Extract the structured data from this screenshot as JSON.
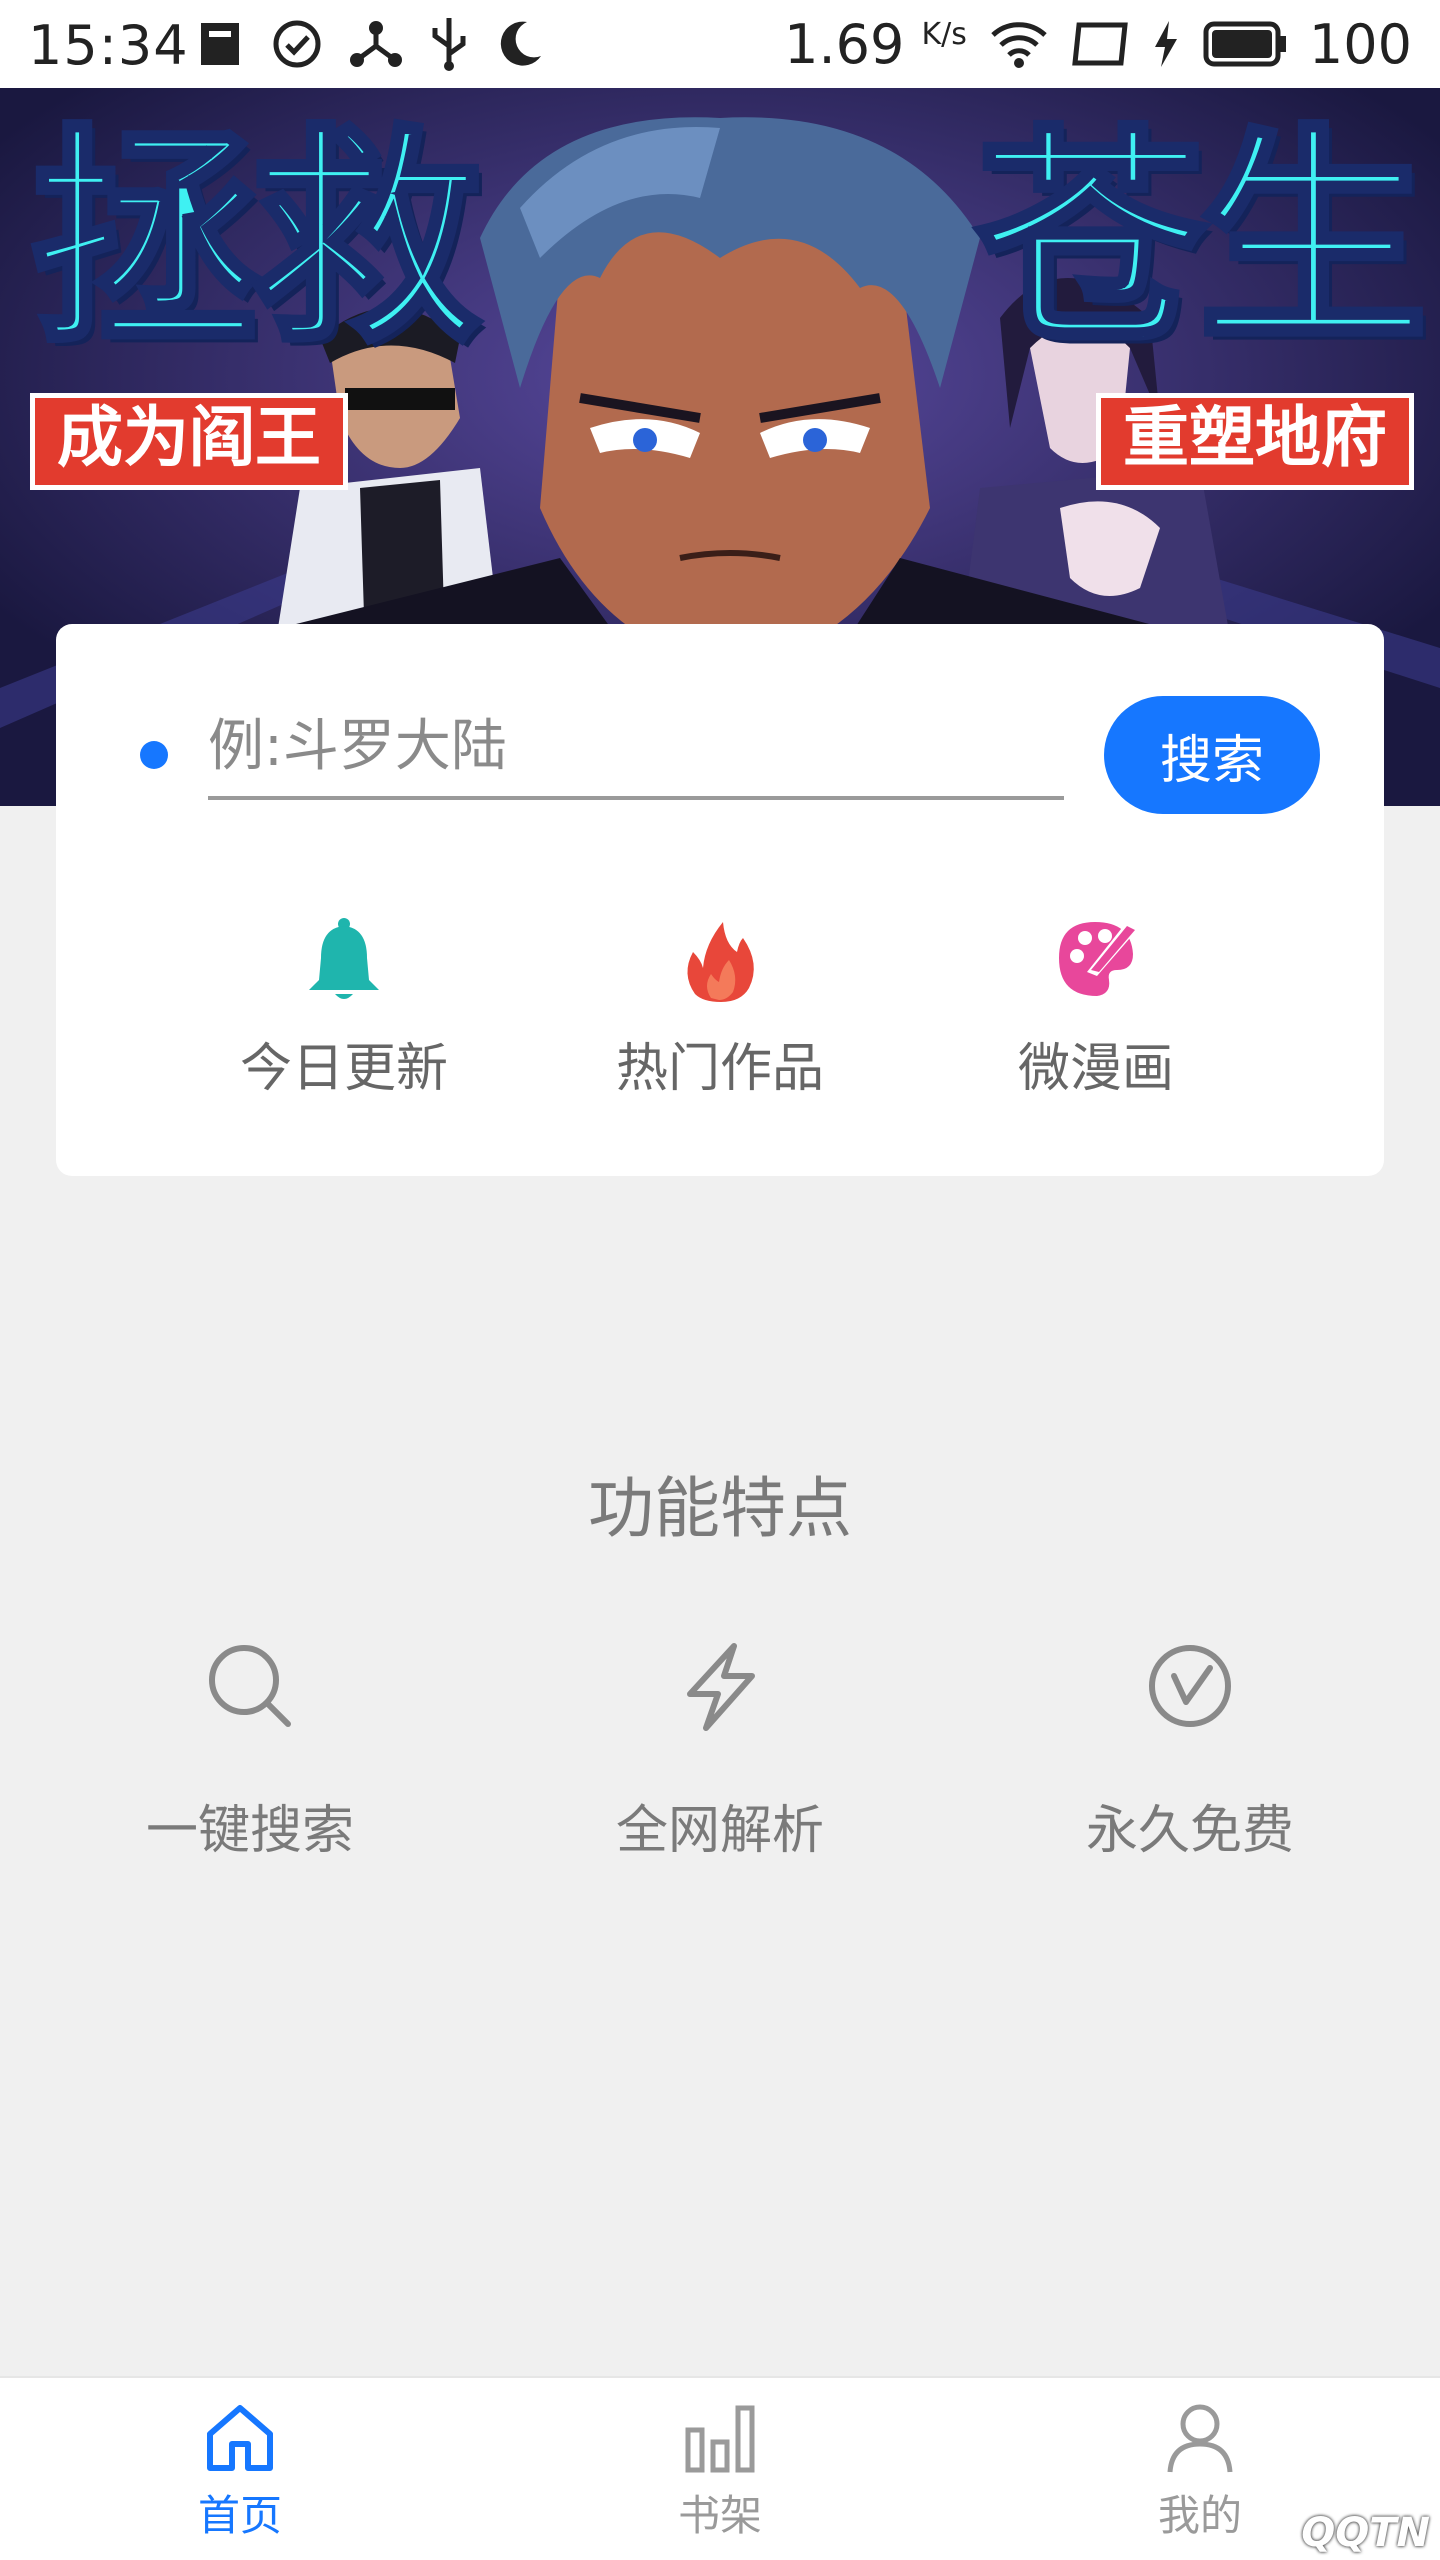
{
  "status_bar": {
    "time": "15:34",
    "net_speed": "1.69",
    "net_speed_unit": "K/s",
    "battery": "100",
    "left_icons": [
      "sd-card-icon",
      "check-circle-icon",
      "share-node-icon",
      "usb-icon",
      "moon-icon"
    ],
    "right_icons": [
      "wifi-icon",
      "screen-icon",
      "charging-icon",
      "battery-icon"
    ]
  },
  "banner": {
    "title_left": "拯救",
    "title_right": "苍生",
    "tag_left": "成为阎王",
    "tag_right": "重塑地府"
  },
  "search": {
    "placeholder": "例:斗罗大陆",
    "value": "",
    "button_label": "搜索"
  },
  "quick_entries": [
    {
      "label": "今日更新",
      "icon": "bell-icon",
      "color": "#1fb5ad"
    },
    {
      "label": "热门作品",
      "icon": "flame-icon",
      "color": "#e8473a"
    },
    {
      "label": "微漫画",
      "icon": "palette-brush-icon",
      "color": "#e8479b"
    }
  ],
  "features": {
    "title": "功能特点",
    "items": [
      {
        "label": "一键搜索",
        "icon": "search-icon"
      },
      {
        "label": "全网解析",
        "icon": "lightning-icon"
      },
      {
        "label": "永久免费",
        "icon": "clock-check-icon"
      }
    ]
  },
  "bottom_nav": {
    "items": [
      {
        "label": "首页",
        "icon": "home-icon",
        "active": true
      },
      {
        "label": "书架",
        "icon": "bar-chart-icon",
        "active": false
      },
      {
        "label": "我的",
        "icon": "user-icon",
        "active": false
      }
    ]
  },
  "watermark": "QQTN",
  "colors": {
    "accent": "#1677ff",
    "background": "#f0f0f0",
    "card": "#ffffff",
    "text_muted": "#7a7a7a"
  }
}
